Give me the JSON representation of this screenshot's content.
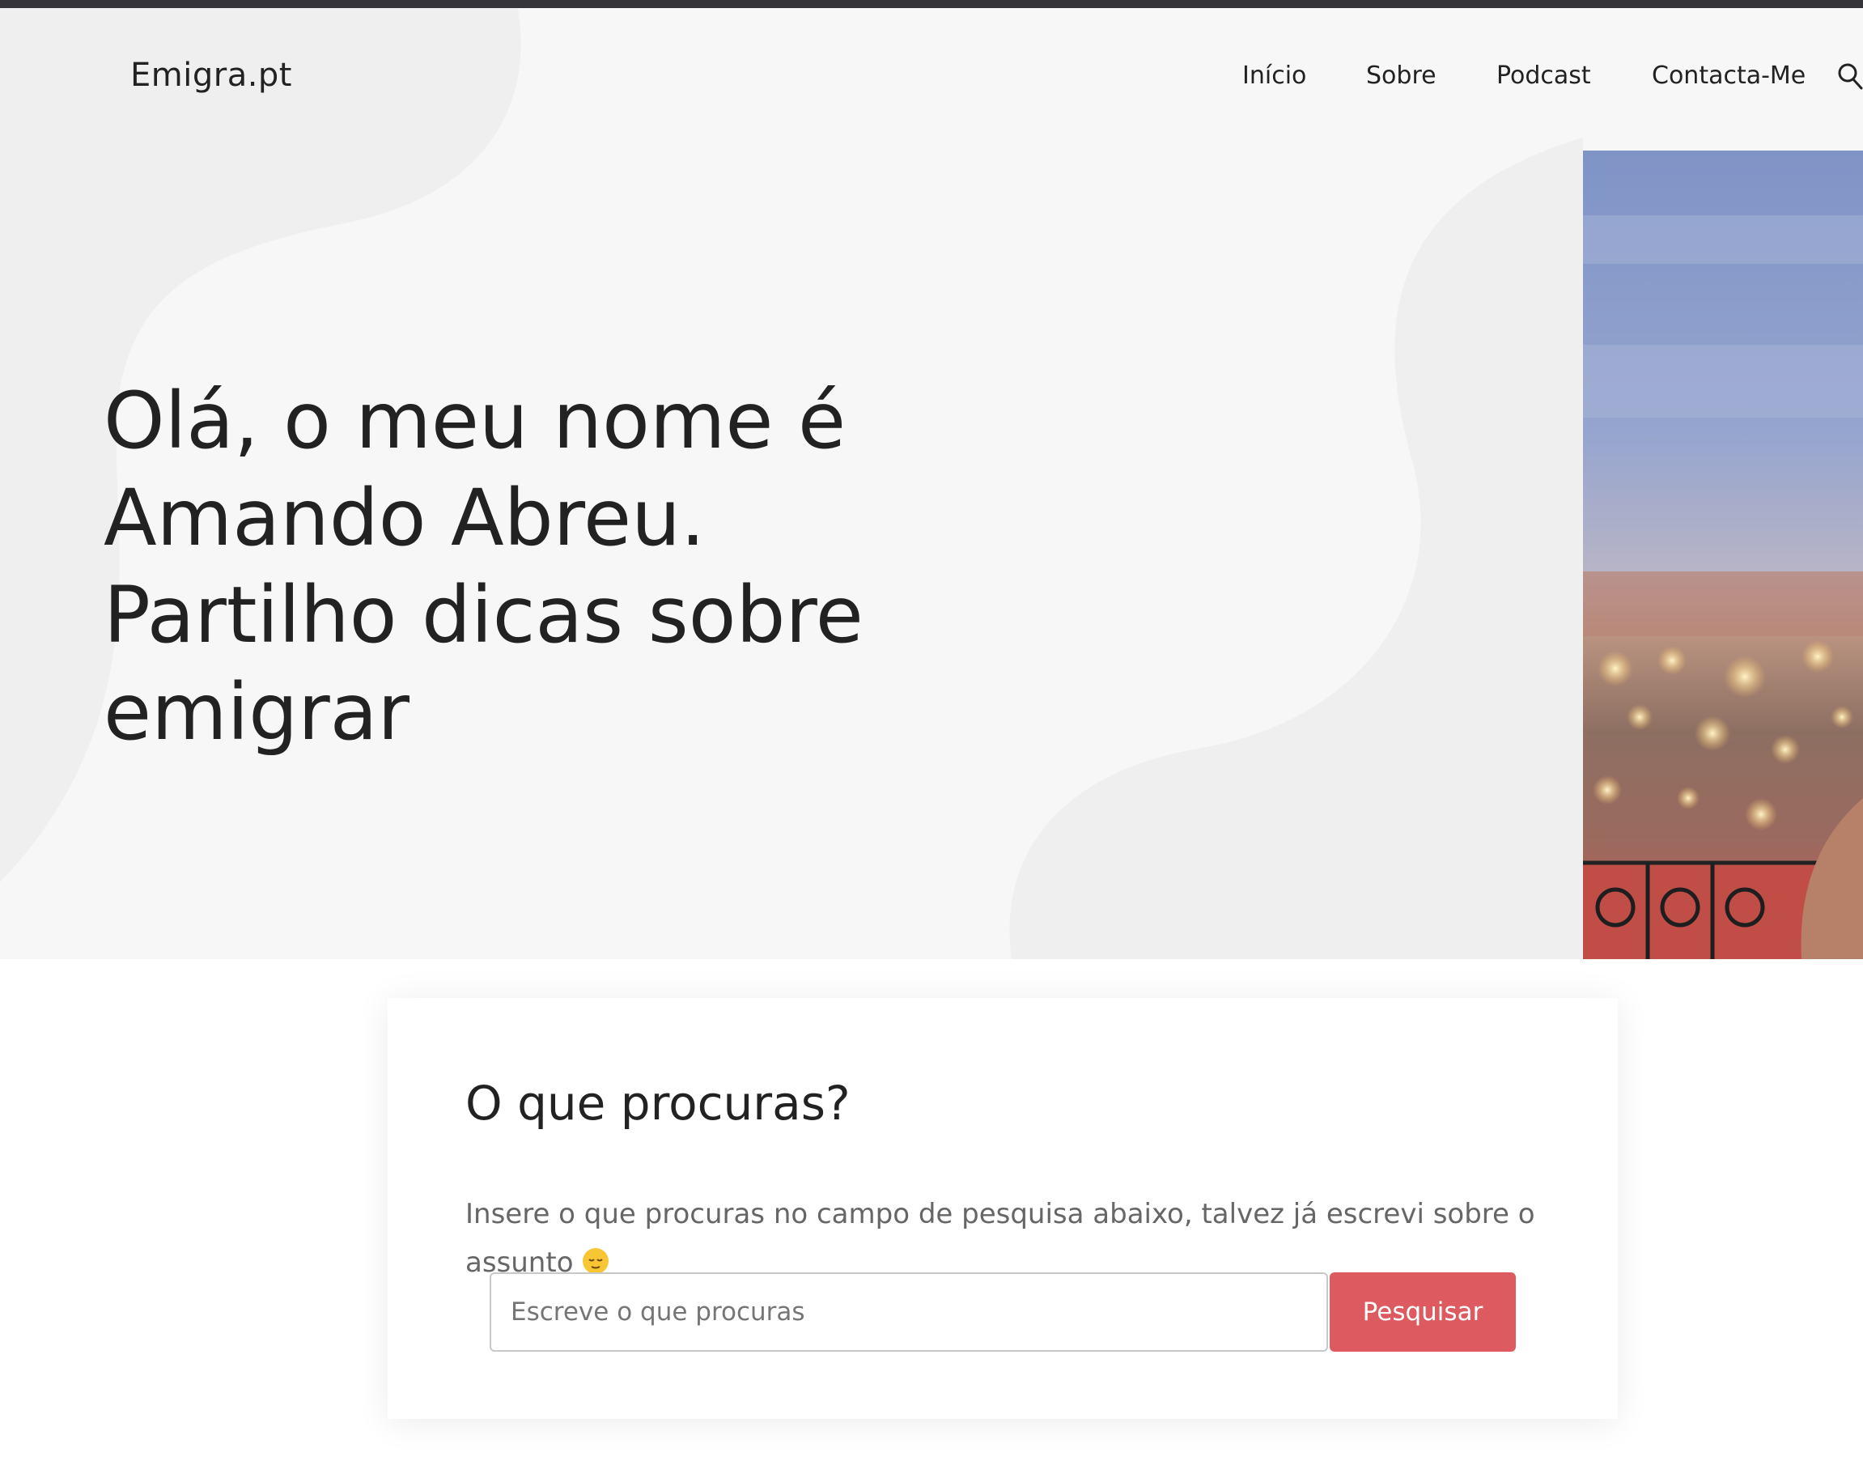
{
  "site": {
    "logo": "Emigra.pt"
  },
  "nav": {
    "items": [
      {
        "label": "Início"
      },
      {
        "label": "Sobre"
      },
      {
        "label": "Podcast"
      },
      {
        "label": "Contacta-Me"
      }
    ],
    "search_icon": "search-icon"
  },
  "hero": {
    "heading_lines": [
      "Olá, o meu nome é",
      "Amando Abreu.",
      "Partilho dicas sobre",
      "emigrar"
    ]
  },
  "search_section": {
    "title": "O que procuras?",
    "description": "Insere o que procuras no campo de pesquisa abaixo, talvez já escrevi sobre o assunto",
    "emoji": "relieved-face-emoji",
    "placeholder": "Escreve o que procuras",
    "button_label": "Pesquisar"
  },
  "colors": {
    "top_bar": "#34343a",
    "hero_background": "#f7f7f7",
    "accent": "#dd5a60",
    "text": "#222222",
    "muted_text": "#666666"
  }
}
